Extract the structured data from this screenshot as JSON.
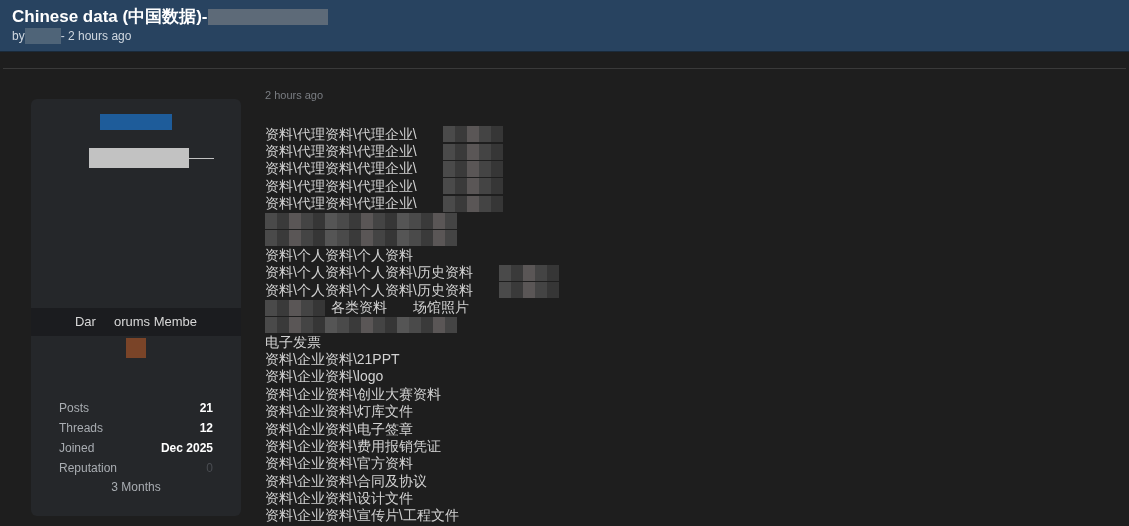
{
  "thread": {
    "title": "Chinese data (中国数据)-",
    "byline_prefix": "by",
    "byline_suffix": "- 2 hours ago"
  },
  "author": {
    "title_parts": [
      "Dar",
      "orums Membe"
    ],
    "stats": [
      {
        "label": "Posts",
        "value": "21",
        "muted": false
      },
      {
        "label": "Threads",
        "value": "12",
        "muted": false
      },
      {
        "label": "Joined",
        "value": "Dec 2025",
        "muted": false
      },
      {
        "label": "Reputation",
        "value": "0",
        "muted": true
      }
    ],
    "tenure": "3 Months"
  },
  "post": {
    "time": "2 hours ago",
    "lines": [
      {
        "parts": [
          {
            "kind": "text",
            "text": "资料\\代理资料\\代理企业\\"
          },
          {
            "kind": "redacted"
          }
        ]
      },
      {
        "parts": [
          {
            "kind": "text",
            "text": "资料\\代理资料\\代理企业\\"
          },
          {
            "kind": "redacted"
          }
        ]
      },
      {
        "parts": [
          {
            "kind": "text",
            "text": "资料\\代理资料\\代理企业\\"
          },
          {
            "kind": "redacted"
          }
        ]
      },
      {
        "parts": [
          {
            "kind": "text",
            "text": "资料\\代理资料\\代理企业\\"
          },
          {
            "kind": "redacted"
          }
        ]
      },
      {
        "parts": [
          {
            "kind": "text",
            "text": "资料\\代理资料\\代理企业\\"
          },
          {
            "kind": "redacted"
          }
        ]
      },
      {
        "parts": [
          {
            "kind": "redacted"
          }
        ]
      },
      {
        "parts": [
          {
            "kind": "redacted"
          }
        ]
      },
      {
        "parts": [
          {
            "kind": "text",
            "text": "资料\\个人资料\\个人资料"
          }
        ]
      },
      {
        "parts": [
          {
            "kind": "text",
            "text": "资料\\个人资料\\个人资料\\历史资料"
          },
          {
            "kind": "redacted"
          }
        ]
      },
      {
        "parts": [
          {
            "kind": "text",
            "text": "资料\\个人资料\\个人资料\\历史资料"
          },
          {
            "kind": "redacted"
          }
        ]
      },
      {
        "parts": [
          {
            "kind": "redacted"
          },
          {
            "kind": "text",
            "text": "各类资料"
          },
          {
            "kind": "text",
            "text": "场馆照片"
          }
        ]
      },
      {
        "parts": [
          {
            "kind": "redacted"
          }
        ]
      },
      {
        "parts": [
          {
            "kind": "text",
            "text": "电子发票"
          }
        ]
      },
      {
        "parts": [
          {
            "kind": "text",
            "text": "资料\\企业资料\\21PPT"
          }
        ]
      },
      {
        "parts": [
          {
            "kind": "text",
            "text": "资料\\企业资料\\logo"
          }
        ]
      },
      {
        "parts": [
          {
            "kind": "text",
            "text": "资料\\企业资料\\创业大赛资料"
          }
        ]
      },
      {
        "parts": [
          {
            "kind": "text",
            "text": "资料\\企业资料\\灯库文件"
          }
        ]
      },
      {
        "parts": [
          {
            "kind": "text",
            "text": "资料\\企业资料\\电子签章"
          }
        ]
      },
      {
        "parts": [
          {
            "kind": "text",
            "text": "资料\\企业资料\\费用报销凭证"
          }
        ]
      },
      {
        "parts": [
          {
            "kind": "text",
            "text": "资料\\企业资料\\官方资料"
          }
        ]
      },
      {
        "parts": [
          {
            "kind": "text",
            "text": "资料\\企业资料\\合同及协议"
          }
        ]
      },
      {
        "parts": [
          {
            "kind": "text",
            "text": "资料\\企业资料\\设计文件"
          }
        ]
      },
      {
        "parts": [
          {
            "kind": "text",
            "text": "资料\\企业资料\\宣传片\\工程文件"
          }
        ]
      }
    ]
  }
}
